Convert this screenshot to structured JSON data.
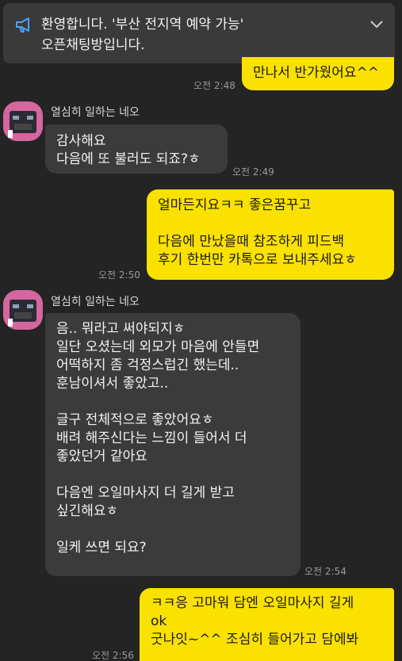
{
  "notice": {
    "text": "환영합니다. '부산 전지역 예약 가능'\n오픈채팅방입니다.",
    "icon": "megaphone-icon",
    "expand_icon": "chevron-down-icon"
  },
  "colors": {
    "my_bubble": "#fae100",
    "other_bubble": "#3b3b3b",
    "background": "#242424"
  },
  "messages": [
    {
      "from": "me",
      "text": "만나서 반가웠어요^^",
      "time": "오전 2:48"
    },
    {
      "from": "other",
      "sender": "열심히 일하는 네오",
      "text": "감사해요\n다음에 또 불러도 되죠?ㅎ",
      "time": "오전 2:49"
    },
    {
      "from": "me",
      "text": "얼마든지요ㅋㅋ 좋은꿈꾸고\n\n다음에 만났을때 참조하게 피드백\n후기 한번만 카톡으로 보내주세요ㅎ",
      "time": "오전 2:50"
    },
    {
      "from": "other",
      "sender": "열심히 일하는 네오",
      "text": "음.. 뭐라고 써야되지ㅎ\n일단 오셨는데 외모가 마음에 안들면\n어떡하지  좀 걱정스럽긴 했는데..\n훈남이셔서 좋았고..\n\n글구 전체적으로 좋았어요ㅎ\n배려 해주신다는 느낌이 들어서 더\n좋았던거 같아요\n\n다음엔 오일마사지 더 길게 받고\n싶긴해요ㅎ\n\n일케 쓰면 되요?",
      "time": "오전 2:54"
    },
    {
      "from": "me",
      "text": "ㅋㅋ응 고마워 담엔 오일마사지 길게\nok\n굿나잇~^^  조심히 들어가고 담에봐",
      "time": "오전 2:56"
    }
  ]
}
